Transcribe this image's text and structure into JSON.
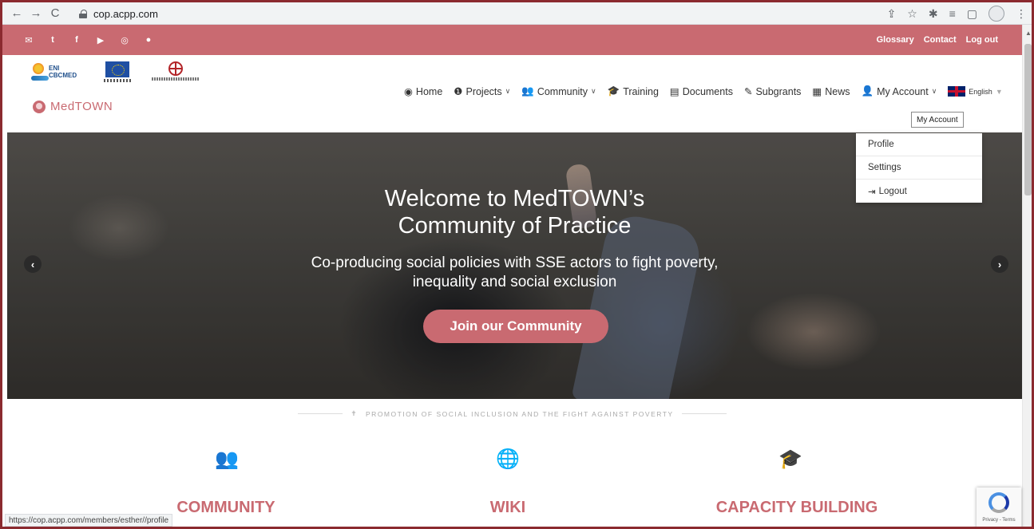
{
  "browser": {
    "url": "cop.acpp.com",
    "status_url": "https://cop.acpp.com/members/esther//profile"
  },
  "utility_bar": {
    "links": [
      "Glossary",
      "Contact",
      "Log out"
    ]
  },
  "header": {
    "brand": "MedTOWN",
    "logo_eni_text": "ENI CBCMED",
    "nav": {
      "home": "Home",
      "projects": "Projects",
      "community": "Community",
      "training": "Training",
      "documents": "Documents",
      "subgrants": "Subgrants",
      "news": "News",
      "my_account": "My Account",
      "language": "English"
    },
    "tooltip": "My Account"
  },
  "dropdown": {
    "items": [
      "Profile",
      "Settings",
      "Logout"
    ]
  },
  "hero": {
    "title_line1": "Welcome to MedTOWN’s",
    "title_line2": "Community of Practice",
    "subtitle_line1": "Co-producing social policies with SSE actors to fight poverty,",
    "subtitle_line2": "inequality and social exclusion",
    "cta": "Join our Community"
  },
  "section": {
    "tagline": "PROMOTION OF SOCIAL INCLUSION AND THE FIGHT AGAINST POVERTY",
    "features": [
      "COMMUNITY",
      "WIKI",
      "CAPACITY BUILDING"
    ]
  },
  "recaptcha": {
    "text": "Privacy - Terms"
  },
  "colors": {
    "accent": "#c96a71",
    "frame": "#8b2a2f"
  }
}
